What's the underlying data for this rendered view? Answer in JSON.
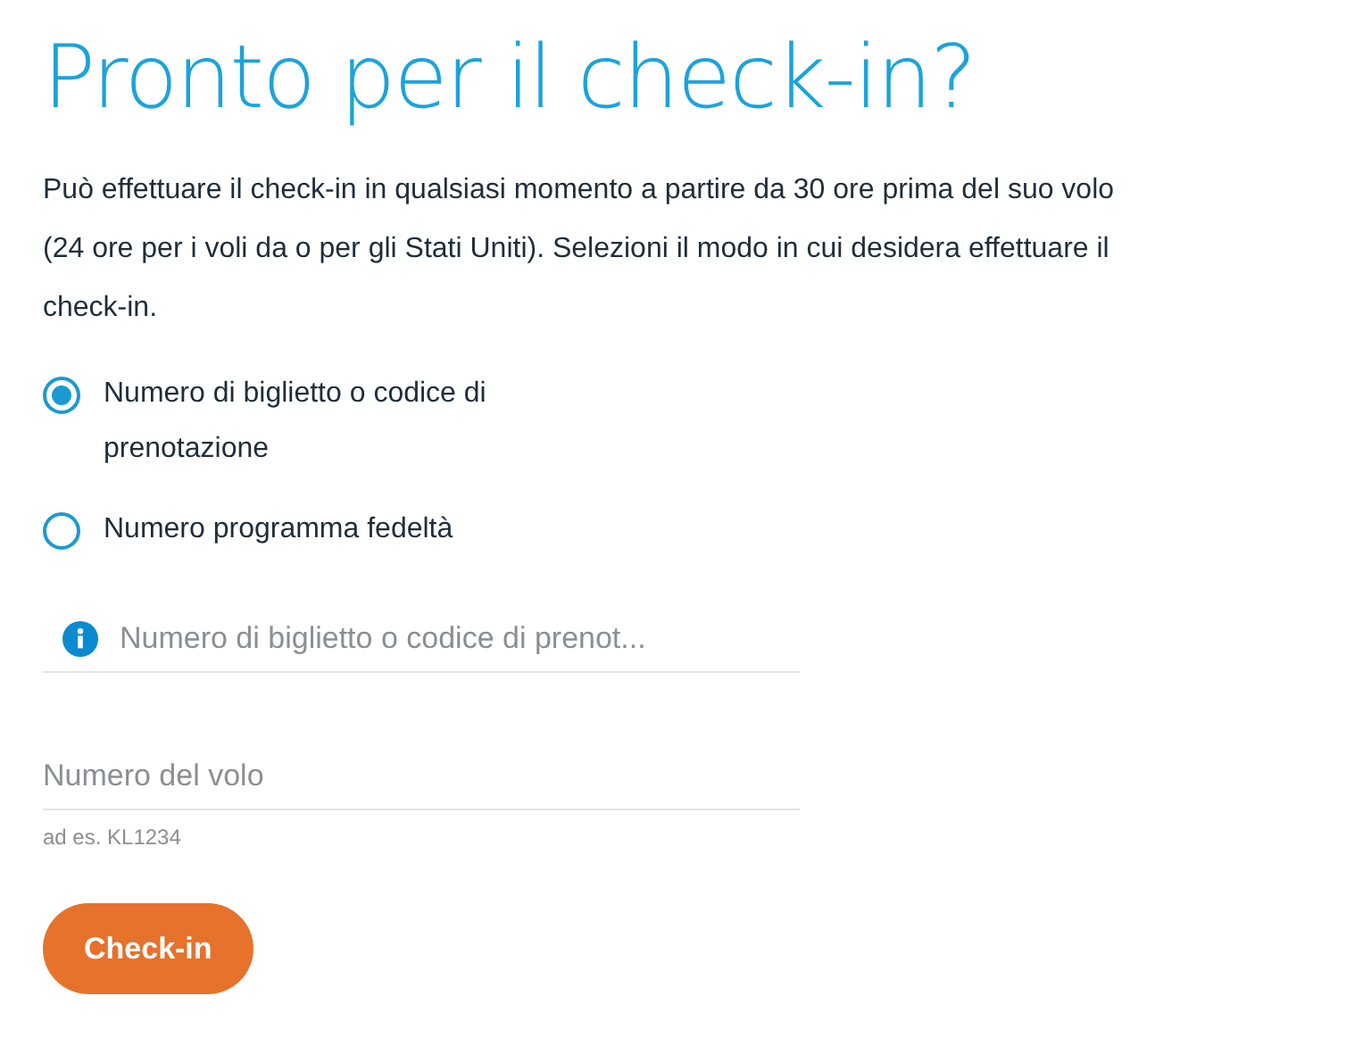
{
  "title": "Pronto per il check-in?",
  "intro": "Può effettuare il check-in in qualsiasi momento a partire da 30 ore prima del suo volo (24 ore per i voli da o per gli Stati Uniti). Selezioni il modo in cui desidera effettuare il check-in.",
  "options": [
    {
      "label": "Numero di biglietto o codice di prenotazione",
      "selected": true
    },
    {
      "label": "Numero programma fedeltà",
      "selected": false
    }
  ],
  "fields": [
    {
      "placeholder": "Numero di biglietto o codice di prenot...",
      "info": true
    },
    {
      "placeholder": "Numero del volo",
      "hint": "ad es. KL1234"
    }
  ],
  "button": "Check-in"
}
